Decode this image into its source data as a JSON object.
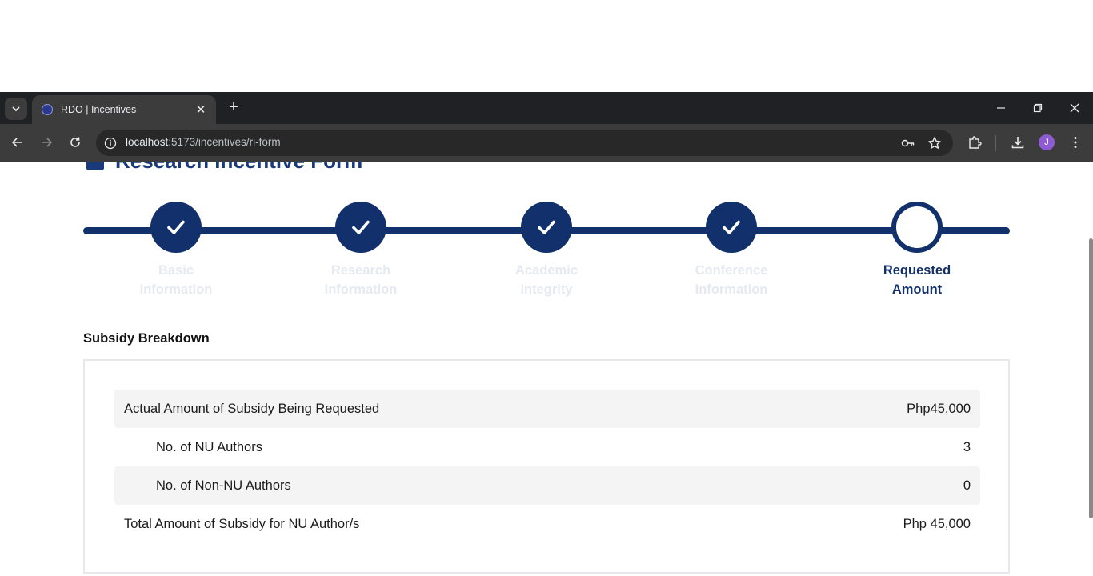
{
  "browser": {
    "tab_title": "RDO | Incentives",
    "url_host": "localhost",
    "url_path": ":5173/incentives/ri-form",
    "profile_initial": "J"
  },
  "page": {
    "title": "Research Incentive Form"
  },
  "stepper": {
    "steps": [
      {
        "line1": "Basic",
        "line2": "Information",
        "state": "completed"
      },
      {
        "line1": "Research",
        "line2": "Information",
        "state": "completed"
      },
      {
        "line1": "Academic",
        "line2": "Integrity",
        "state": "completed"
      },
      {
        "line1": "Conference",
        "line2": "Information",
        "state": "completed"
      },
      {
        "line1": "Requested",
        "line2": "Amount",
        "state": "current"
      }
    ]
  },
  "subsidy": {
    "section_title": "Subsidy Breakdown",
    "rows": [
      {
        "label": "Actual Amount of Subsidy Being Requested",
        "value": "Php45,000"
      },
      {
        "label": "No. of NU Authors",
        "value": "3"
      },
      {
        "label": "No. of Non-NU Authors",
        "value": "0"
      },
      {
        "label": "Total Amount of Subsidy for NU Author/s",
        "value": "Php 45,000"
      }
    ]
  },
  "colors": {
    "primary": "#12306b",
    "inactive_label": "#e5e9f0",
    "chrome_dark": "#202124",
    "chrome_toolbar": "#3c3c3c"
  }
}
